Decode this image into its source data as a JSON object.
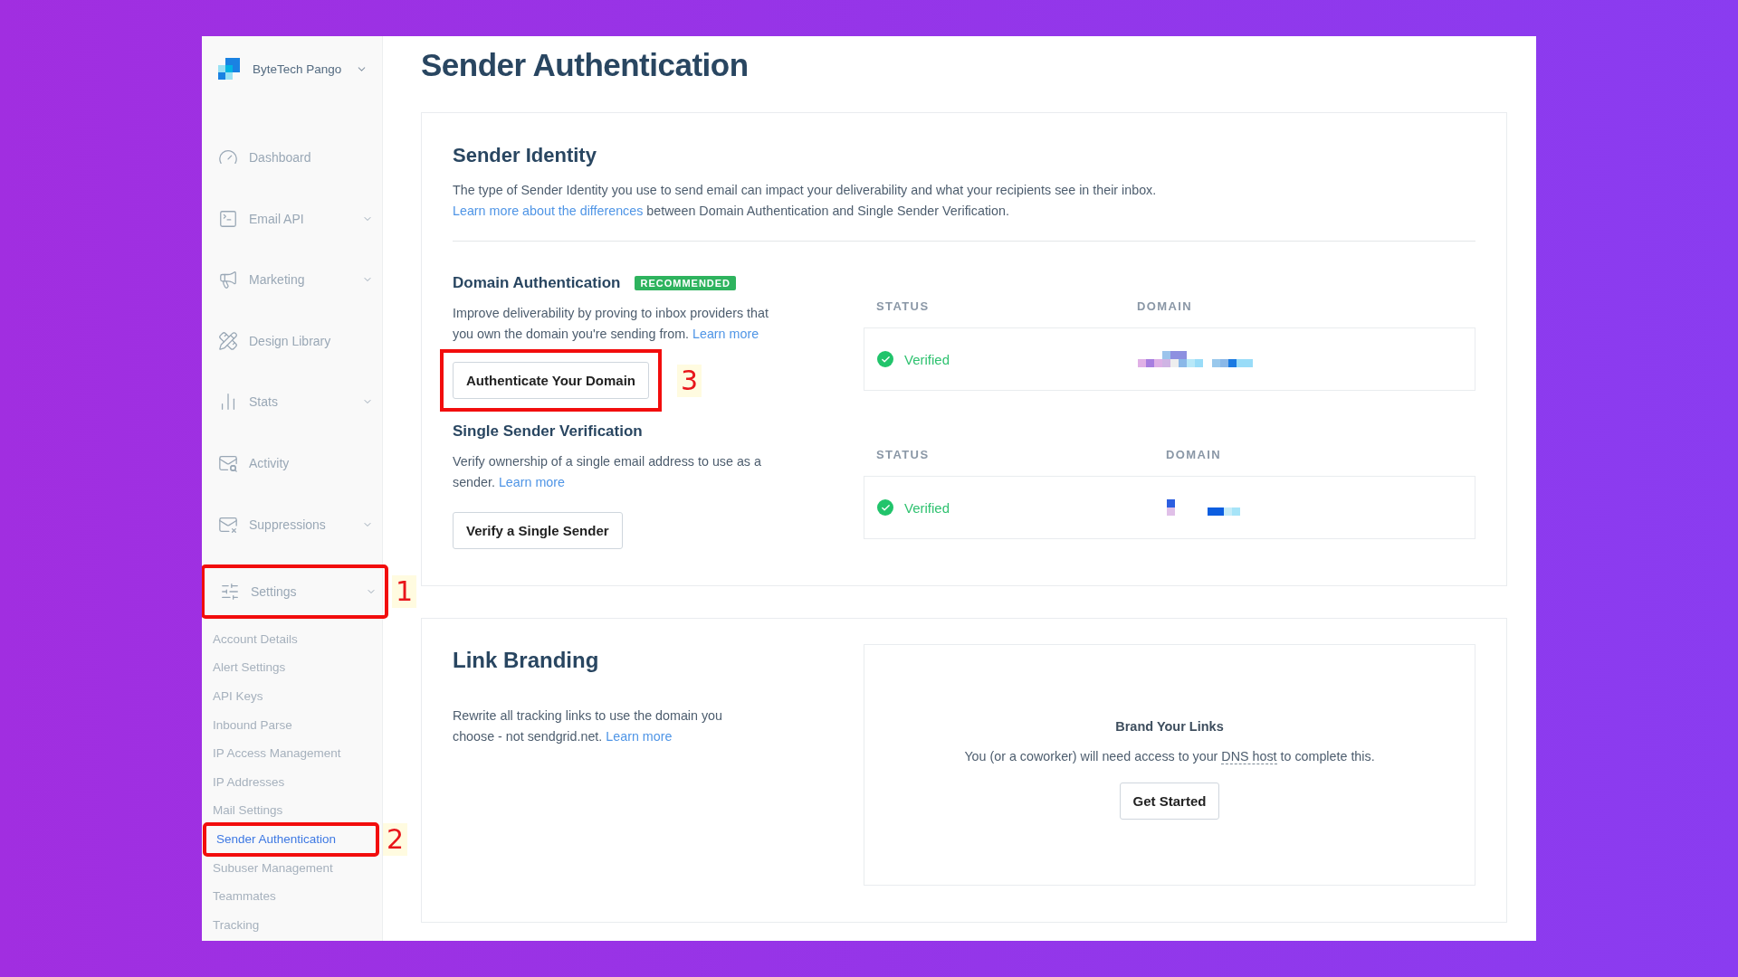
{
  "account": {
    "name": "ByteTech Pango"
  },
  "nav": [
    {
      "label": "Dashboard",
      "kind": "dashboard",
      "expandable": false
    },
    {
      "label": "Email API",
      "kind": "api",
      "expandable": true
    },
    {
      "label": "Marketing",
      "kind": "marketing",
      "expandable": true
    },
    {
      "label": "Design Library",
      "kind": "design",
      "expandable": false
    },
    {
      "label": "Stats",
      "kind": "stats",
      "expandable": true
    },
    {
      "label": "Activity",
      "kind": "activity",
      "expandable": false
    },
    {
      "label": "Suppressions",
      "kind": "suppressions",
      "expandable": true
    },
    {
      "label": "Settings",
      "kind": "settings",
      "expandable": true,
      "annotation": "1",
      "children": [
        {
          "label": "Account Details",
          "selected": false
        },
        {
          "label": "Alert Settings",
          "selected": false
        },
        {
          "label": "API Keys",
          "selected": false
        },
        {
          "label": "Inbound Parse",
          "selected": false
        },
        {
          "label": "IP Access Management",
          "selected": false
        },
        {
          "label": "IP Addresses",
          "selected": false
        },
        {
          "label": "Mail Settings",
          "selected": false
        },
        {
          "label": "Sender Authentication",
          "selected": true,
          "annotation": "2"
        },
        {
          "label": "Subuser Management",
          "selected": false
        },
        {
          "label": "Teammates",
          "selected": false
        },
        {
          "label": "Tracking",
          "selected": false
        }
      ]
    }
  ],
  "page": {
    "title": "Sender Authentication"
  },
  "sender_identity": {
    "title": "Sender Identity",
    "text": "The type of Sender Identity you use to send email can impact your deliverability and what your recipients see in their inbox.",
    "link": "Learn more about the differences",
    "text_after": " between Domain Authentication and Single Sender Verification."
  },
  "sections": [
    {
      "title": "Domain Authentication",
      "badge": "RECOMMENDED",
      "text": "Improve deliverability by proving to inbox providers that you own the domain you're sending from. ",
      "link": "Learn more",
      "button": "Authenticate Your Domain",
      "annotation": "3",
      "columns": [
        "STATUS",
        "DOMAIN"
      ],
      "rows": [
        {
          "status": "Verified",
          "verified": true
        }
      ]
    },
    {
      "title": "Single Sender Verification",
      "text": "Verify ownership of a single email address to use as a sender. ",
      "link": "Learn more",
      "button": "Verify a Single Sender",
      "columns": [
        "STATUS",
        "DOMAIN"
      ],
      "rows": [
        {
          "status": "Verified",
          "verified": true
        }
      ]
    }
  ],
  "link_branding": {
    "title": "Link Branding",
    "text": "Rewrite all tracking links to use the domain you choose - not sendgrid.net. ",
    "link": "Learn more",
    "panel": {
      "title": "Brand Your Links",
      "text": "You (or a coworker) will need access to your ",
      "link": "DNS host",
      "text_after": " to complete this.",
      "button": "Get Started"
    }
  }
}
